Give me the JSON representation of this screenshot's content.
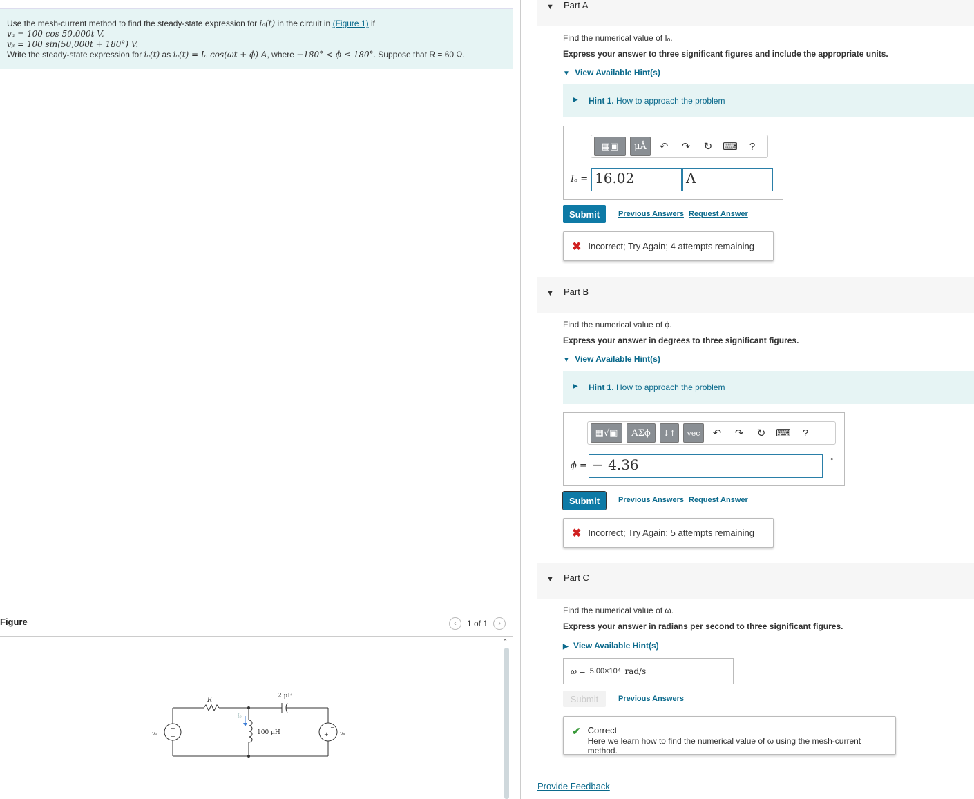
{
  "problem": {
    "intro": "Use the mesh-current method to find the steady-state expression for",
    "io_t": "iₒ(t)",
    "in_circuit": "in the circuit in",
    "figure_link": "(Figure 1)",
    "if_text": "if",
    "va_eq": "vₐ = 100 cos 50,000t V,",
    "vb_eq": "vᵦ = 100 sin(50,000t + 180°) V.",
    "write_text": "Write the steady-state expression for",
    "as_text": "as",
    "expr": "iₒ(t) = Iₒ cos(ωt + ϕ) A",
    "where_text": ", where",
    "range": "−180° < ϕ ≤ 180°",
    "suppose": ". Suppose that R = 60 Ω."
  },
  "figure": {
    "title": "Figure",
    "pager": "1 of 1",
    "labels": {
      "R": "R",
      "cap": "2 μF",
      "ind": "100 μH",
      "io": "iₒ",
      "va": "vₐ",
      "vb": "vᵦ",
      "plus": "+",
      "minus": "−"
    }
  },
  "partA": {
    "title": "Part A",
    "question": "Find the numerical value of Iₒ.",
    "instruction": "Express your answer to three significant figures and include the appropriate units.",
    "hints_link": "View Available Hint(s)",
    "hint_num": "Hint 1.",
    "hint_text": "How to approach the problem",
    "tb_units": "μÅ",
    "var_label": "Iₒ =",
    "value": "16.02",
    "unit": "A",
    "submit": "Submit",
    "prev_answers": "Previous Answers",
    "request_answer": "Request Answer",
    "feedback": "Incorrect; Try Again; 4 attempts remaining"
  },
  "partB": {
    "title": "Part B",
    "question": "Find the numerical value of ϕ.",
    "instruction": "Express your answer in degrees to three significant figures.",
    "hints_link": "View Available Hint(s)",
    "hint_num": "Hint 1.",
    "hint_text": "How to approach the problem",
    "tb_greek": "ΑΣϕ",
    "tb_arrows": "↓↑",
    "tb_vec": "vec",
    "var_label": "ϕ =",
    "value": "− 4.36",
    "unit_symbol": "°",
    "submit": "Submit",
    "prev_answers": "Previous Answers",
    "request_answer": "Request Answer",
    "feedback": "Incorrect; Try Again; 5 attempts remaining"
  },
  "partC": {
    "title": "Part C",
    "question": "Find the numerical value of ω.",
    "instruction": "Express your answer in radians per second to three significant figures.",
    "hints_link": "View Available Hint(s)",
    "answer_label": "ω =",
    "answer_value": "5.00×10⁴",
    "answer_unit": "rad/s",
    "submit": "Submit",
    "prev_answers": "Previous Answers",
    "feedback_title": "Correct",
    "feedback_text": "Here we learn how to find the numerical value of ω using the mesh-current method."
  },
  "footer": {
    "provide_feedback": "Provide Feedback"
  },
  "colors": {
    "accent": "#0e7aa6",
    "hint_bg": "#e6f4f4",
    "incorrect": "#d02020",
    "correct": "#3a9a3a"
  }
}
